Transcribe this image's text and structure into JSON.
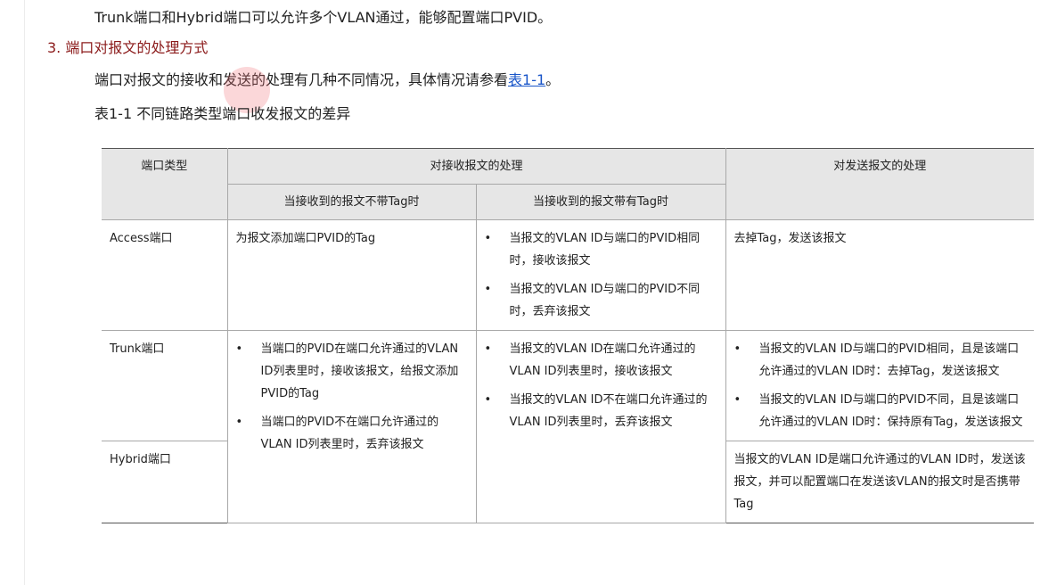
{
  "intro": "Trunk端口和Hybrid端口可以允许多个VLAN通过，能够配置端口PVID。",
  "section_heading": "3. 端口对报文的处理方式",
  "para": {
    "before": "端口对报文的接收和发送的处理有几种不同情况，具体情况请参看",
    "link": "表1-1",
    "after": "。"
  },
  "caption": "表1-1 不同链路类型端口收发报文的差异",
  "colors": {
    "heading": "#8b1a1a",
    "link": "#1a56c9",
    "header_bg": "#e6e6e6"
  },
  "table": {
    "headers": {
      "port_type": "端口类型",
      "receive": "对接收报文的处理",
      "receive_untagged": "当接收到的报文不带Tag时",
      "receive_tagged": "当接收到的报文带有Tag时",
      "send": "对发送报文的处理"
    },
    "access": {
      "type": "Access端口",
      "untagged": "为报文添加端口PVID的Tag",
      "tagged": [
        "当报文的VLAN ID与端口的PVID相同时，接收该报文",
        "当报文的VLAN ID与端口的PVID不同时，丢弃该报文"
      ],
      "send": "去掉Tag，发送该报文"
    },
    "trunk": {
      "type": "Trunk端口",
      "untagged": [
        "当端口的PVID在端口允许通过的VLAN ID列表里时，接收该报文，给报文添加PVID的Tag",
        "当端口的PVID不在端口允许通过的VLAN ID列表里时，丢弃该报文"
      ],
      "tagged": [
        "当报文的VLAN ID在端口允许通过的VLAN ID列表里时，接收该报文",
        "当报文的VLAN ID不在端口允许通过的VLAN ID列表里时，丢弃该报文"
      ],
      "send": [
        "当报文的VLAN ID与端口的PVID相同，且是该端口允许通过的VLAN ID时：去掉Tag，发送该报文",
        "当报文的VLAN ID与端口的PVID不同，且是该端口允许通过的VLAN ID时：保持原有Tag，发送该报文"
      ]
    },
    "hybrid": {
      "type": "Hybrid端口",
      "send": "当报文的VLAN ID是端口允许通过的VLAN ID时，发送该报文，并可以配置端口在发送该VLAN的报文时是否携带Tag"
    }
  }
}
